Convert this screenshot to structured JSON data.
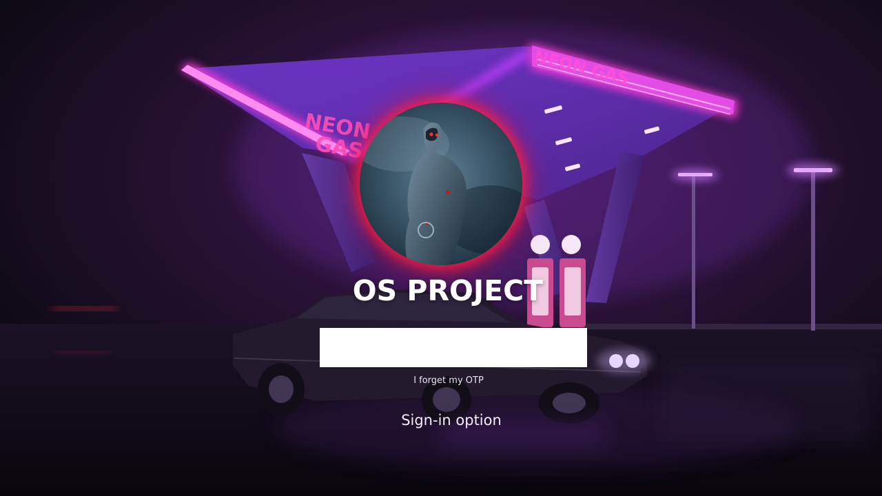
{
  "lock_screen": {
    "title": "OS PROJECT",
    "otp_field": {
      "value": "",
      "placeholder": ""
    },
    "forgot_otp_label": "I forget my OTP",
    "signin_option_label": "Sign-in option"
  },
  "background": {
    "scene": "neon-gas-station-wallpaper",
    "sign_text_left": "NEON GAS",
    "sign_text_right": "NEON GAS"
  },
  "avatar": {
    "icon": "user-avatar-armored-figure"
  },
  "colors": {
    "accent_glow": "#ff1e3c",
    "neon_pink": "#ff3ad7",
    "neon_violet": "#8a3cff",
    "background": "#0b0810"
  }
}
